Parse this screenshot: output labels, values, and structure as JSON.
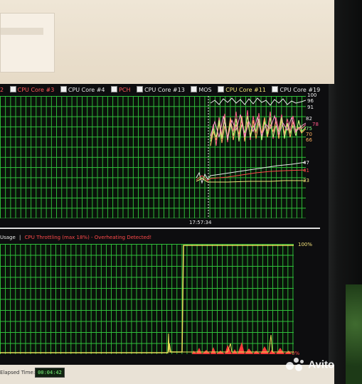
{
  "legend": [
    {
      "label": "2",
      "color": "red"
    },
    {
      "label": "CPU Core #3",
      "color": "red"
    },
    {
      "label": "CPU Core #4",
      "color": "white"
    },
    {
      "label": "PCH",
      "color": "red"
    },
    {
      "label": "CPU Core #13",
      "color": "white"
    },
    {
      "label": "MOS",
      "color": "white"
    },
    {
      "label": "CPU Core #11",
      "color": "yellow"
    },
    {
      "label": "CPU Core #19",
      "color": "white"
    }
  ],
  "temperature_scale": {
    "v100": "100",
    "v96": "96",
    "v91": "91",
    "v82": "82",
    "v78": "78",
    "v75": "75",
    "v70": "70",
    "v66": "66",
    "v47": "47",
    "v41": "41",
    "v33": "33"
  },
  "time_marker": "17:57:34",
  "status": {
    "usage": "Usage",
    "separator": "|",
    "throttling": "CPU Throttling (max 18%) - Overheating Detected!"
  },
  "usage_scale": {
    "top": "100%",
    "bottom": "0%"
  },
  "footer": {
    "elapsed_label": "Elapsed Time:",
    "elapsed_value": "00:04:42"
  },
  "watermark": "Avito",
  "colors": {
    "grid": "#2fbf3a",
    "chart_bg": "#0a120a",
    "throttle_text": "#ff4a4a",
    "usage_line": "#e8e05a"
  }
}
